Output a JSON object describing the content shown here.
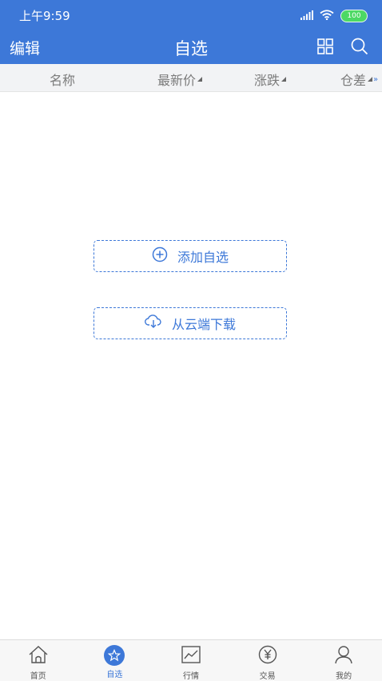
{
  "status_bar": {
    "time": "上午9:59",
    "battery": "100",
    "icons": [
      "signal-icon",
      "wifi-icon",
      "battery-icon"
    ]
  },
  "nav": {
    "edit_label": "编辑",
    "title": "自选",
    "icons": [
      "grid-icon",
      "search-icon"
    ]
  },
  "columns": {
    "name": "名称",
    "latest_price": "最新价",
    "change": "涨跌",
    "position_diff": "仓差"
  },
  "actions": {
    "add": "添加自选",
    "download": "从云端下载"
  },
  "tabs": [
    {
      "label": "首页",
      "icon": "home-icon"
    },
    {
      "label": "自选",
      "icon": "star-icon"
    },
    {
      "label": "行情",
      "icon": "chart-icon"
    },
    {
      "label": "交易",
      "icon": "yen-icon"
    },
    {
      "label": "我的",
      "icon": "user-icon"
    }
  ],
  "colors": {
    "primary": "#3d78d8",
    "header_bg": "#f2f3f5",
    "tabbar_bg": "#f7f7f7"
  }
}
